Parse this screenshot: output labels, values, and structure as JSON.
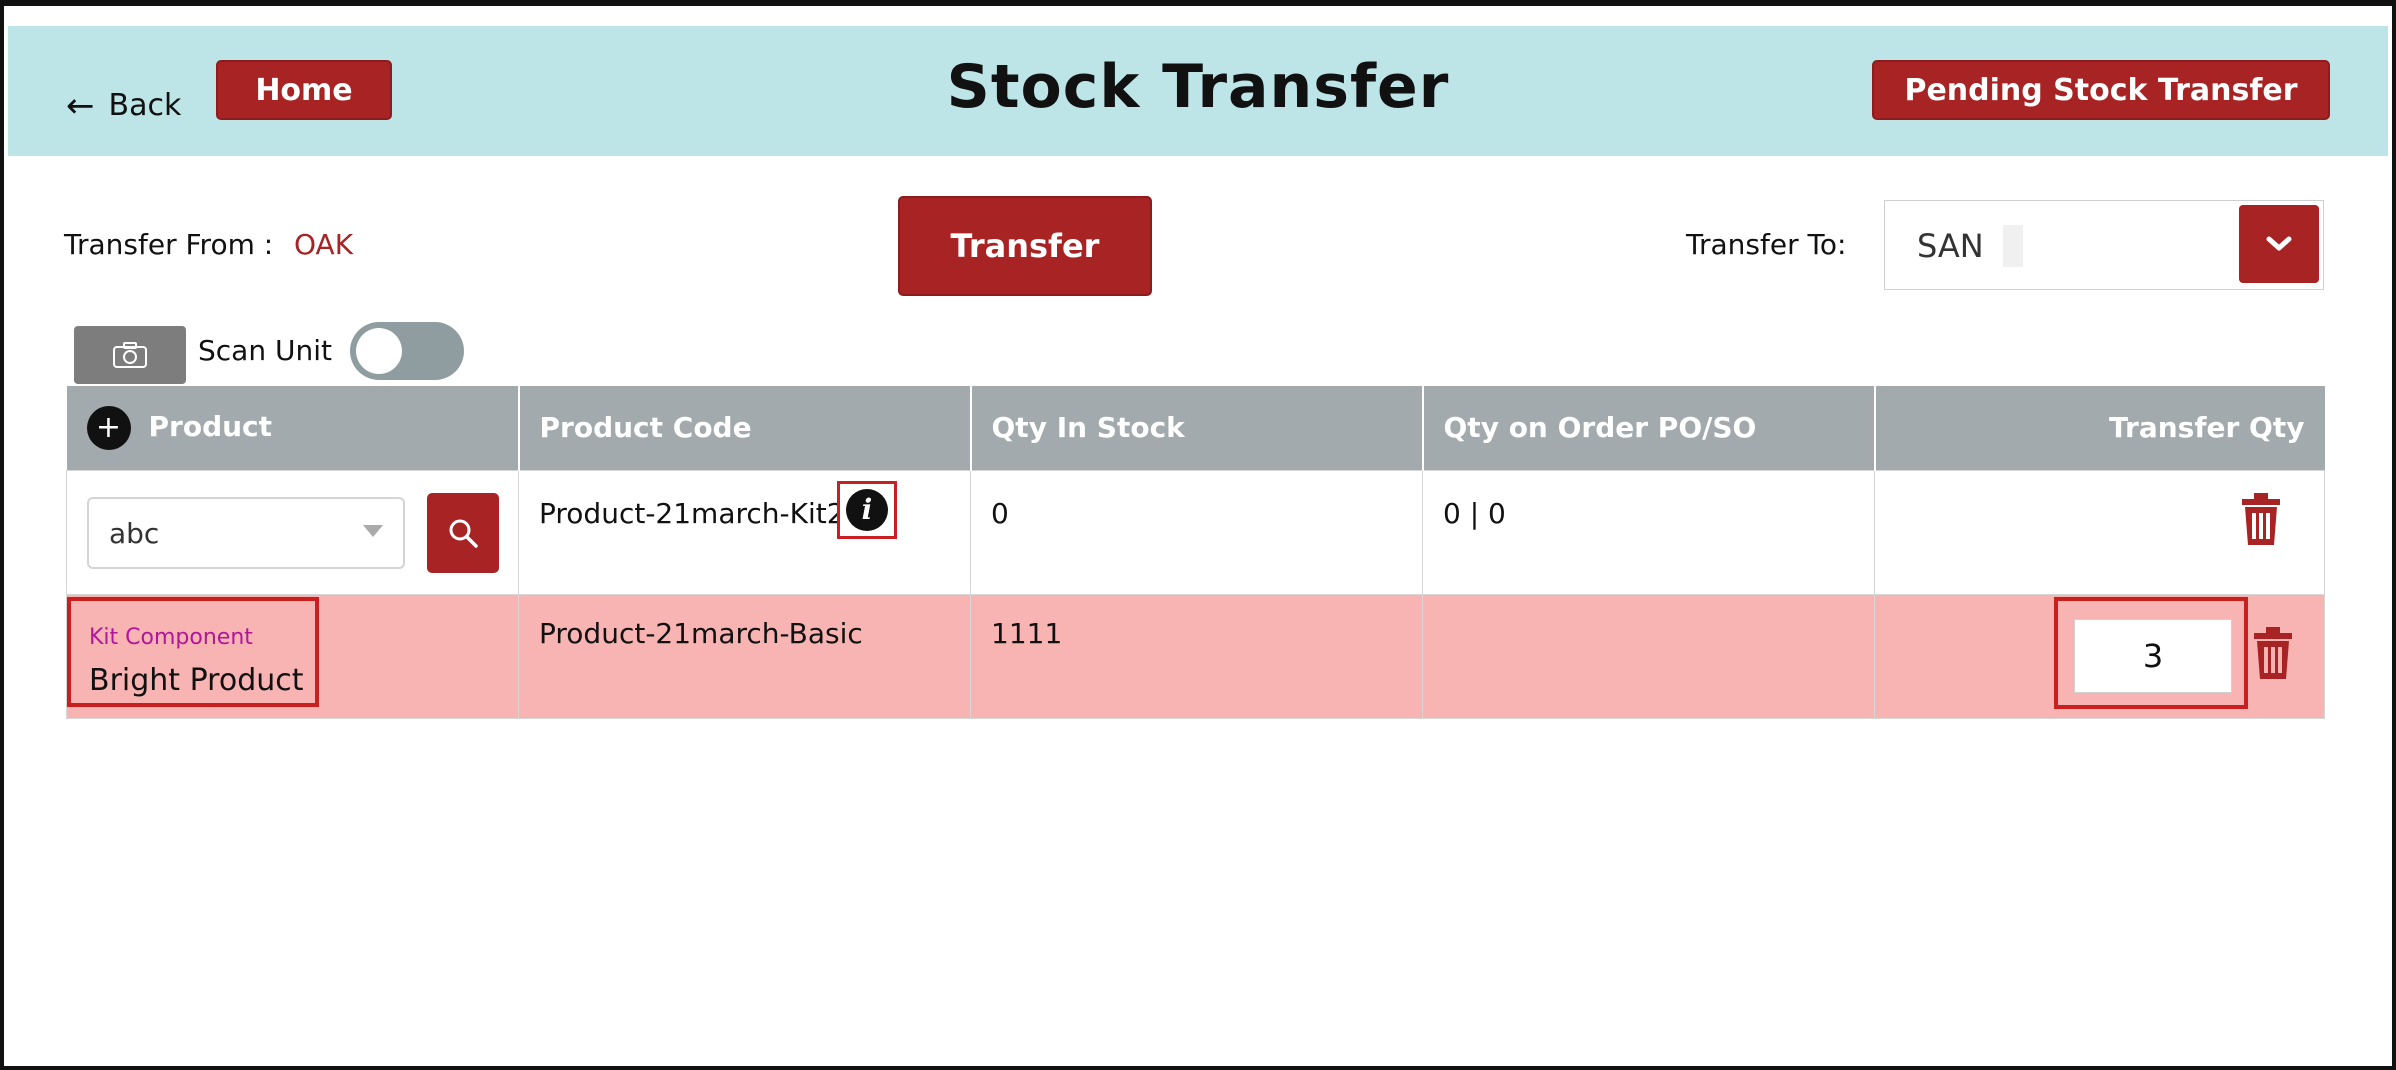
{
  "header": {
    "back_label": "Back",
    "home_label": "Home",
    "title": "Stock Transfer",
    "pending_label": "Pending Stock Transfer"
  },
  "transfer": {
    "from_label": "Transfer From :",
    "from_value": "OAK",
    "button_label": "Transfer",
    "to_label": "Transfer To:",
    "to_value": "SAN"
  },
  "scan": {
    "label": "Scan Unit",
    "enabled": false
  },
  "table": {
    "columns": [
      "Product",
      "Product Code",
      "Qty In Stock",
      "Qty on Order PO/SO",
      "Transfer Qty"
    ],
    "rows": [
      {
        "product_input": "abc",
        "product_code": "Product-21march-Kit2",
        "qty_in_stock": "0",
        "qty_on_order": "0 | 0",
        "transfer_qty": ""
      },
      {
        "kit_label": "Kit Component",
        "product_name": "Bright Product",
        "product_code": "Product-21march-Basic",
        "qty_in_stock": "1111",
        "qty_on_order": "",
        "transfer_qty": "3"
      }
    ]
  },
  "colors": {
    "brand_red": "#a82323",
    "header_bg": "#bde4e6",
    "kit_row_bg": "#f8b3b3",
    "table_header_bg": "#a2aaad",
    "kit_label": "#b0179b"
  }
}
